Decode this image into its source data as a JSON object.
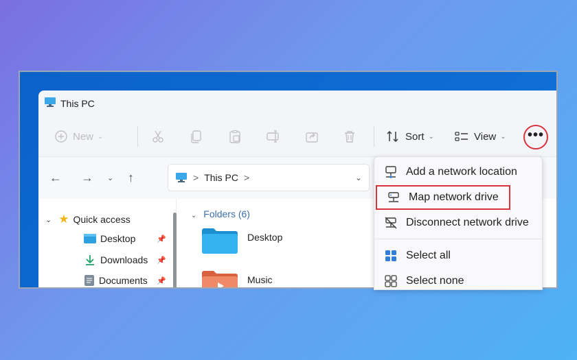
{
  "window": {
    "title": "This PC"
  },
  "toolbar": {
    "new_label": "New",
    "sort_label": "Sort",
    "view_label": "View",
    "more_label": "•••"
  },
  "address": {
    "location": "This PC",
    "chevron": ">"
  },
  "sidebar": {
    "quick_access": "Quick access",
    "items": [
      {
        "label": "Desktop"
      },
      {
        "label": "Downloads"
      },
      {
        "label": "Documents"
      }
    ]
  },
  "main": {
    "folders_heading": "Folders (6)",
    "folders": [
      {
        "label": "Desktop"
      },
      {
        "label": "Music"
      }
    ]
  },
  "menu": {
    "items": [
      {
        "label": "Add a network location"
      },
      {
        "label": "Map network drive"
      },
      {
        "label": "Disconnect network drive"
      },
      {
        "label": "Select all"
      },
      {
        "label": "Select none"
      }
    ]
  },
  "colors": {
    "highlight": "#d8333c",
    "folder_blue": "#29a4e0",
    "folder_orange": "#e8795a",
    "accent_link": "#3a6fb0"
  }
}
